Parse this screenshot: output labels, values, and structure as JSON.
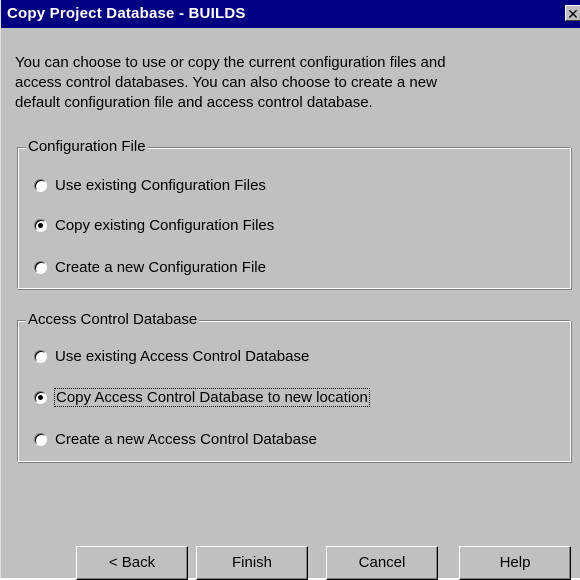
{
  "window": {
    "title": "Copy Project Database - BUILDS",
    "close_glyph": "✕"
  },
  "intro": {
    "lines": [
      "You can choose to use or copy the current configuration files and",
      "access control databases.  You can also choose to create a new",
      "default configuration file and access control database."
    ]
  },
  "config_group": {
    "legend": "Configuration File",
    "options": [
      {
        "label": "Use existing Configuration Files",
        "checked": false
      },
      {
        "label": "Copy existing Configuration Files",
        "checked": true
      },
      {
        "label": "Create a new Configuration File",
        "checked": false
      }
    ]
  },
  "acl_group": {
    "legend": "Access Control Database",
    "options": [
      {
        "label": "Use existing Access Control Database",
        "checked": false
      },
      {
        "label": "Copy Access Control Database to new location",
        "checked": true
      },
      {
        "label": "Create a new Access Control Database",
        "checked": false
      }
    ]
  },
  "buttons": {
    "back": "< Back",
    "finish": "Finish",
    "cancel": "Cancel",
    "help": "Help"
  }
}
